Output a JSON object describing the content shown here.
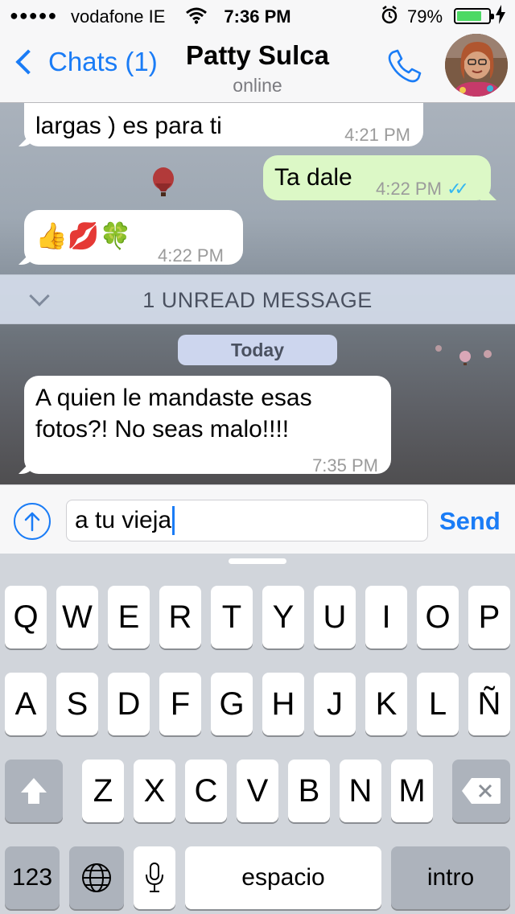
{
  "status_bar": {
    "signal": "●●●●●",
    "carrier": "vodafone IE",
    "time": "7:36 PM",
    "battery_pct": "79%",
    "battery_level": 0.79,
    "icons": [
      "signal-dots-icon",
      "wifi-icon",
      "alarm-clock-icon",
      "battery-icon",
      "charging-bolt-icon"
    ]
  },
  "header": {
    "back_label": "Chats (1)",
    "contact_name": "Patty Sulca",
    "contact_status": "online",
    "icons": [
      "back-chevron-icon",
      "phone-icon"
    ]
  },
  "messages": [
    {
      "direction": "in",
      "text_partial_top": "",
      "text": "largas ) es para ti",
      "time": "4:21 PM"
    },
    {
      "direction": "out",
      "text": "Ta dale",
      "time": "4:22 PM",
      "status": "read"
    },
    {
      "direction": "in",
      "text": "👍💋🍀",
      "time": "4:22 PM"
    },
    {
      "direction": "in",
      "text_line1": "A quien le mandaste esas",
      "text_line2": "fotos?! No seas malo!!!!",
      "time": "7:35 PM"
    }
  ],
  "unread_banner": "1 UNREAD MESSAGE",
  "date_label": "Today",
  "input": {
    "value": "a tu vieja",
    "send_label": "Send"
  },
  "keyboard": {
    "row1": [
      "Q",
      "W",
      "E",
      "R",
      "T",
      "Y",
      "U",
      "I",
      "O",
      "P"
    ],
    "row2": [
      "A",
      "S",
      "D",
      "F",
      "G",
      "H",
      "J",
      "K",
      "L",
      "Ñ"
    ],
    "row3": [
      "Z",
      "X",
      "C",
      "V",
      "B",
      "N",
      "M"
    ],
    "numbers_label": "123",
    "space_label": "espacio",
    "return_label": "intro",
    "icons": [
      "shift-icon",
      "delete-icon",
      "globe-icon",
      "microphone-icon"
    ]
  },
  "colors": {
    "accent": "#1a7cf6",
    "outgoing_bubble": "#dcf8c6",
    "incoming_bubble": "#ffffff",
    "read_ticks": "#34b7f1",
    "battery_fill": "#4cd964"
  }
}
